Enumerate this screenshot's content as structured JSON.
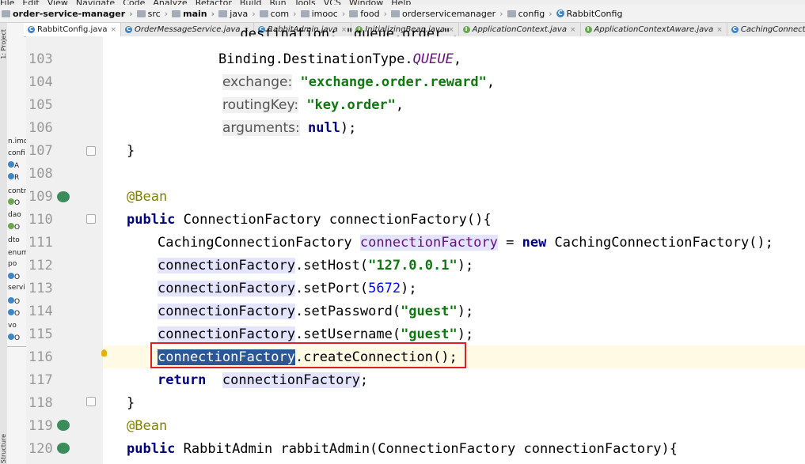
{
  "menubar": {
    "items": [
      "File",
      "Edit",
      "View",
      "Navigate",
      "Code",
      "Analyze",
      "Refactor",
      "Build",
      "Run",
      "Tools",
      "VCS",
      "Window",
      "Help"
    ]
  },
  "breadcrumb": [
    "order-service-manager",
    "src",
    "main",
    "java",
    "com",
    "imooc",
    "food",
    "orderservicemanager",
    "config",
    "RabbitConfig"
  ],
  "tabs": [
    "RabbitConfig.java",
    "OrderMessageService.java",
    "RabbitAdmin.java",
    "InitializingBean.java",
    "ApplicationContext.java",
    "ApplicationContextAware.java",
    "CachingConnectionFactory.java",
    "C"
  ],
  "sidepanel": {
    "label": "1: Project",
    "bottom_label": "Structure",
    "items": [
      "n.imo",
      "confi",
      "A",
      "R",
      "contr",
      "O",
      "dao",
      "O",
      "dto",
      "enum",
      "po",
      "O",
      "servi",
      "O",
      "O",
      "vo",
      "O"
    ]
  },
  "code": {
    "partial_top": "destination: \"queue.order\",",
    "lines": [
      {
        "no": "103",
        "parts": [
          [
            "Binding.DestinationType.",
            ""
          ],
          [
            "QUEUE",
            "itconst"
          ],
          [
            ",",
            ""
          ]
        ]
      },
      {
        "no": "104",
        "parts": [
          [
            "exchange:",
            "hint"
          ],
          [
            " ",
            ""
          ],
          [
            "\"exchange.order.reward\"",
            "str"
          ],
          [
            ",",
            ""
          ]
        ]
      },
      {
        "no": "105",
        "parts": [
          [
            "routingKey:",
            "hint"
          ],
          [
            " ",
            ""
          ],
          [
            "\"key.order\"",
            "str"
          ],
          [
            ",",
            ""
          ]
        ]
      },
      {
        "no": "106",
        "parts": [
          [
            "arguments:",
            "hint"
          ],
          [
            " ",
            ""
          ],
          [
            "null",
            "kw"
          ],
          [
            ");",
            ""
          ]
        ]
      },
      {
        "no": "107",
        "parts": [
          [
            "}",
            ""
          ]
        ]
      },
      {
        "no": "108",
        "parts": []
      },
      {
        "no": "109",
        "parts": [
          [
            "@Bean",
            "ann"
          ]
        ]
      },
      {
        "no": "110",
        "parts": [
          [
            "public",
            "kw"
          ],
          [
            " ConnectionFactory connectionFactory(){",
            ""
          ]
        ]
      },
      {
        "no": "111",
        "parts": [
          [
            "CachingConnectionFactory ",
            ""
          ],
          [
            "connectionFactory",
            "purple var"
          ],
          [
            " = ",
            ""
          ],
          [
            "new",
            "kw"
          ],
          [
            " CachingConnectionFactory();",
            ""
          ]
        ]
      },
      {
        "no": "112",
        "parts": [
          [
            "connectionFactory",
            "var"
          ],
          [
            ".setHost(",
            ""
          ],
          [
            "\"127.0.0.1\"",
            "str"
          ],
          [
            ");",
            ""
          ]
        ]
      },
      {
        "no": "113",
        "parts": [
          [
            "connectionFactory",
            "var"
          ],
          [
            ".setPort(",
            ""
          ],
          [
            "5672",
            "num"
          ],
          [
            ");",
            ""
          ]
        ]
      },
      {
        "no": "114",
        "parts": [
          [
            "connectionFactory",
            "var"
          ],
          [
            ".setPassword(",
            ""
          ],
          [
            "\"guest\"",
            "str"
          ],
          [
            ");",
            ""
          ]
        ]
      },
      {
        "no": "115",
        "parts": [
          [
            "connectionFactory",
            "var"
          ],
          [
            ".setUsername(",
            ""
          ],
          [
            "\"guest\"",
            "str"
          ],
          [
            ");",
            ""
          ]
        ]
      },
      {
        "no": "116",
        "parts": [
          [
            "connectionFactory",
            "sel"
          ],
          [
            ".createConnection();",
            ""
          ]
        ]
      },
      {
        "no": "117",
        "parts": [
          [
            "return",
            "kw"
          ],
          [
            "  ",
            ""
          ],
          [
            "connectionFactory",
            "var"
          ],
          [
            ";",
            ""
          ]
        ]
      },
      {
        "no": "118",
        "parts": [
          [
            "}",
            ""
          ]
        ]
      },
      {
        "no": "119",
        "parts": [
          [
            "@Bean",
            "ann"
          ]
        ]
      },
      {
        "no": "120",
        "parts": [
          [
            "public",
            "kw"
          ],
          [
            " RabbitAdmin rabbitAdmin(ConnectionFactory connectionFactory){",
            ""
          ]
        ]
      }
    ]
  },
  "colors": {
    "highlight_box": "#e02020",
    "selection": "#2b5797",
    "string": "#117811",
    "keyword": "#000080"
  }
}
